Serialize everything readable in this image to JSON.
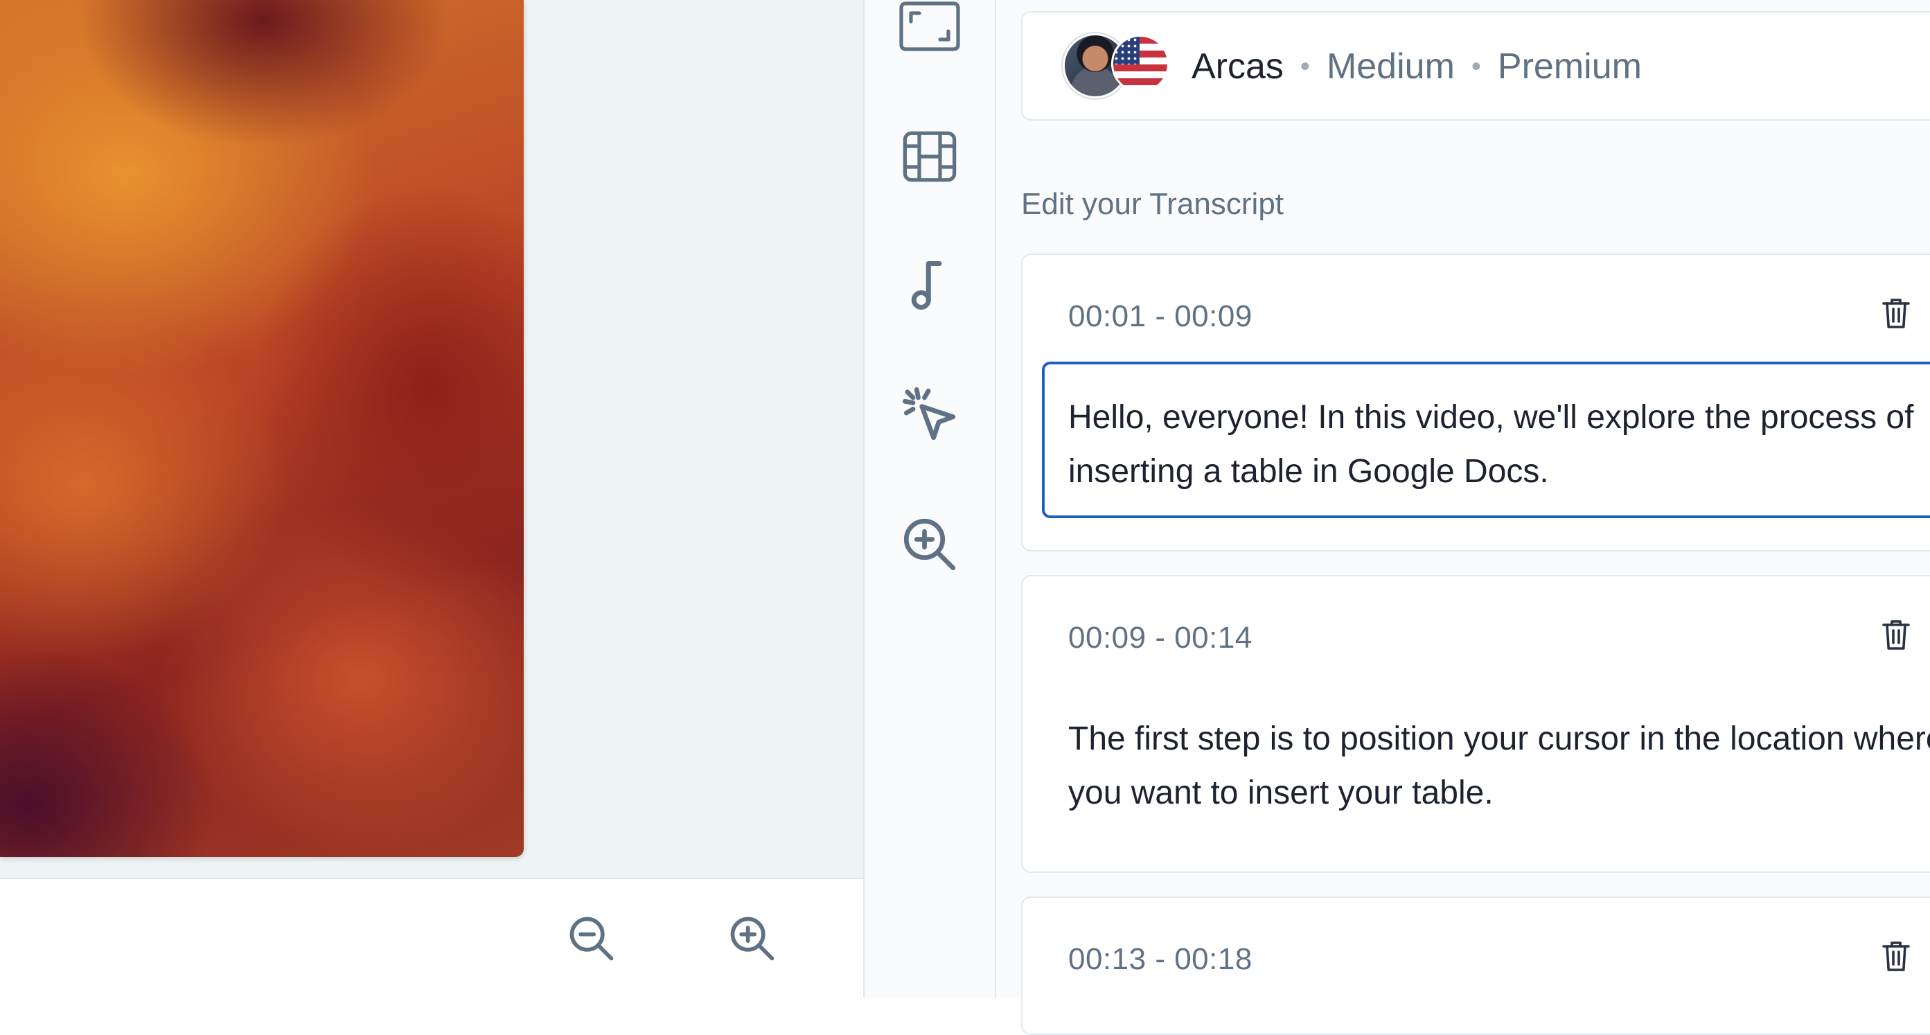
{
  "canvas": {
    "zoom_out_icon": "zoom-out-icon",
    "zoom_in_icon": "zoom-in-icon"
  },
  "tool_rail": {
    "items": [
      {
        "name": "aspect-ratio",
        "icon": "frame-icon"
      },
      {
        "name": "media",
        "icon": "film-icon"
      },
      {
        "name": "music",
        "icon": "music-note-icon"
      },
      {
        "name": "click-effects",
        "icon": "cursor-click-icon"
      },
      {
        "name": "zoom",
        "icon": "zoom-plus-icon"
      }
    ]
  },
  "avatar": {
    "name": "Arcas",
    "size": "Medium",
    "tier": "Premium"
  },
  "transcript": {
    "title": "Edit your Transcript",
    "segments": [
      {
        "time": "00:01 - 00:09",
        "text": "Hello, everyone! In this video, we'll explore the process of inserting a table in Google Docs.",
        "active": true
      },
      {
        "time": "00:09 - 00:14",
        "text": "The first step is to position your cursor in the location where you want to insert your table.",
        "active": false
      },
      {
        "time": "00:13 - 00:18",
        "text": "",
        "active": false
      }
    ]
  },
  "colors": {
    "accent": "#1f5fbd",
    "muted_text": "#5f7184",
    "border": "#e3e8ec"
  }
}
